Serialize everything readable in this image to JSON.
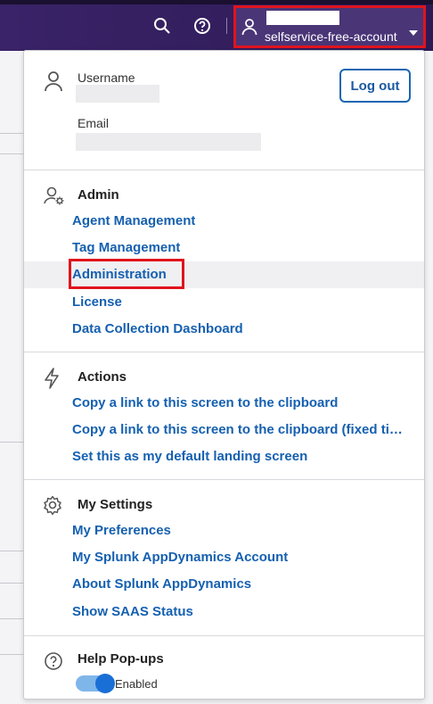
{
  "topbar": {
    "account_label": "selfservice-free-account"
  },
  "user": {
    "username_label": "Username",
    "email_label": "Email",
    "logout_label": "Log out"
  },
  "admin": {
    "title": "Admin",
    "items": [
      "Agent Management",
      "Tag Management",
      "Administration",
      "License",
      "Data Collection Dashboard"
    ]
  },
  "actions": {
    "title": "Actions",
    "items": [
      "Copy a link to this screen to the clipboard",
      "Copy a link to this screen to the clipboard (fixed time range)",
      "Set this as my default landing screen"
    ]
  },
  "settings": {
    "title": "My Settings",
    "items": [
      "My Preferences",
      "My Splunk AppDynamics Account",
      "About Splunk AppDynamics",
      "Show SAAS Status"
    ]
  },
  "help": {
    "title": "Help Pop-ups",
    "toggle_label": "Enabled",
    "toggle_on": true
  },
  "colors": {
    "topbar": "#3a2368",
    "link": "#1560b0",
    "highlight": "#e0141e"
  }
}
